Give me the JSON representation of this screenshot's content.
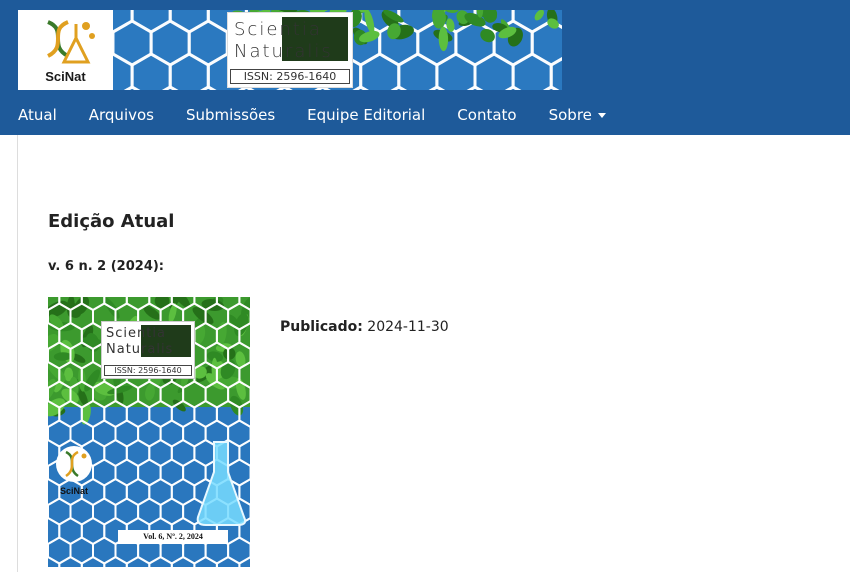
{
  "brand": {
    "logo_text": "SciNat",
    "title_line1": "Scientia",
    "title_line2": "Naturalis",
    "issn": "ISSN: 2596-1640"
  },
  "nav": {
    "items": [
      {
        "label": "Atual"
      },
      {
        "label": "Arquivos"
      },
      {
        "label": "Submissões"
      },
      {
        "label": "Equipe Editorial"
      },
      {
        "label": "Contato"
      },
      {
        "label": "Sobre"
      }
    ]
  },
  "main": {
    "page_title": "Edição Atual",
    "issue_identification": "v. 6 n. 2 (2024):",
    "published_label": "Publicado:",
    "published_date": "2024-11-30"
  },
  "cover": {
    "title_line1": "Scientia",
    "title_line2": "Naturalis",
    "issn": "ISSN: 2596-1640",
    "logo_text": "SciNat",
    "volume_text": "Vol. 6, Nº. 2, 2024"
  },
  "colors": {
    "header_bg": "#1e5a9a",
    "hex_blue": "#2b79c0",
    "leaf_green": "#3e9a2c",
    "title_dark": "#1f3b1a"
  }
}
